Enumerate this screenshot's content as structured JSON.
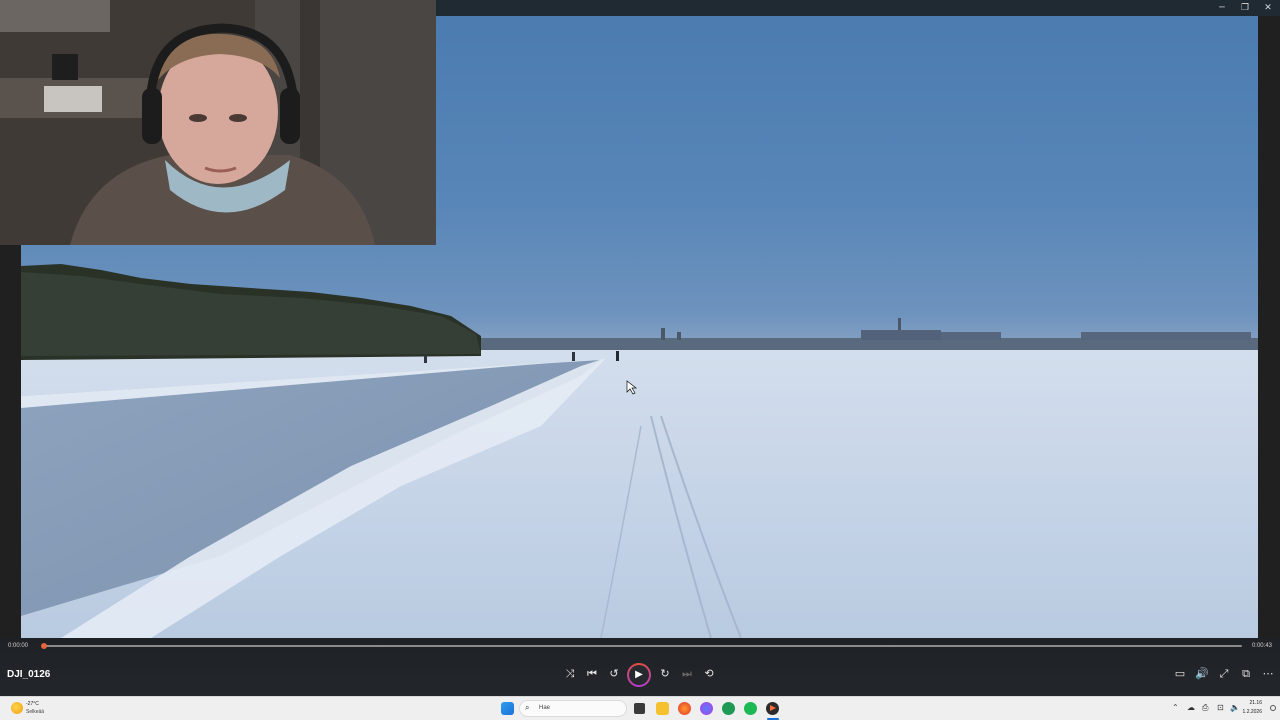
{
  "window": {
    "minimize_glyph": "─",
    "maximize_glyph": "❐",
    "close_glyph": "✕"
  },
  "player": {
    "file_title": "DJI_0126",
    "time_current": "0:00:00",
    "time_total": "0:00:43",
    "progress_fraction": 0.002,
    "controls": [
      {
        "name": "shuffle-icon",
        "glyph": "⤨",
        "enabled": true
      },
      {
        "name": "previous-icon",
        "glyph": "⏮",
        "enabled": true
      },
      {
        "name": "rewind-10-icon",
        "glyph": "↺",
        "enabled": true
      },
      {
        "name": "forward-30-icon",
        "glyph": "↻",
        "enabled": true
      },
      {
        "name": "next-icon",
        "glyph": "⏭",
        "enabled": false
      },
      {
        "name": "repeat-icon",
        "glyph": "⟲",
        "enabled": true
      }
    ],
    "play_glyph": "▶",
    "right_controls": [
      {
        "name": "subtitles-icon",
        "glyph": "▭"
      },
      {
        "name": "volume-icon",
        "glyph": "🔊"
      },
      {
        "name": "fullscreen-icon",
        "glyph": "⤢"
      },
      {
        "name": "mini-player-icon",
        "glyph": "⧉"
      },
      {
        "name": "more-options-icon",
        "glyph": "⋯"
      }
    ],
    "accent_color": "#e8643b"
  },
  "taskbar": {
    "weather_temp": "-27°C",
    "weather_desc": "Selkeää",
    "search_placeholder": "Hae",
    "search_glyph": "⌕",
    "tray_glyphs": [
      "⌃",
      "☁",
      "⎙",
      "⊡",
      "🔈",
      "▭"
    ],
    "clock_time": "21.16",
    "clock_date": "1.2.2026"
  }
}
